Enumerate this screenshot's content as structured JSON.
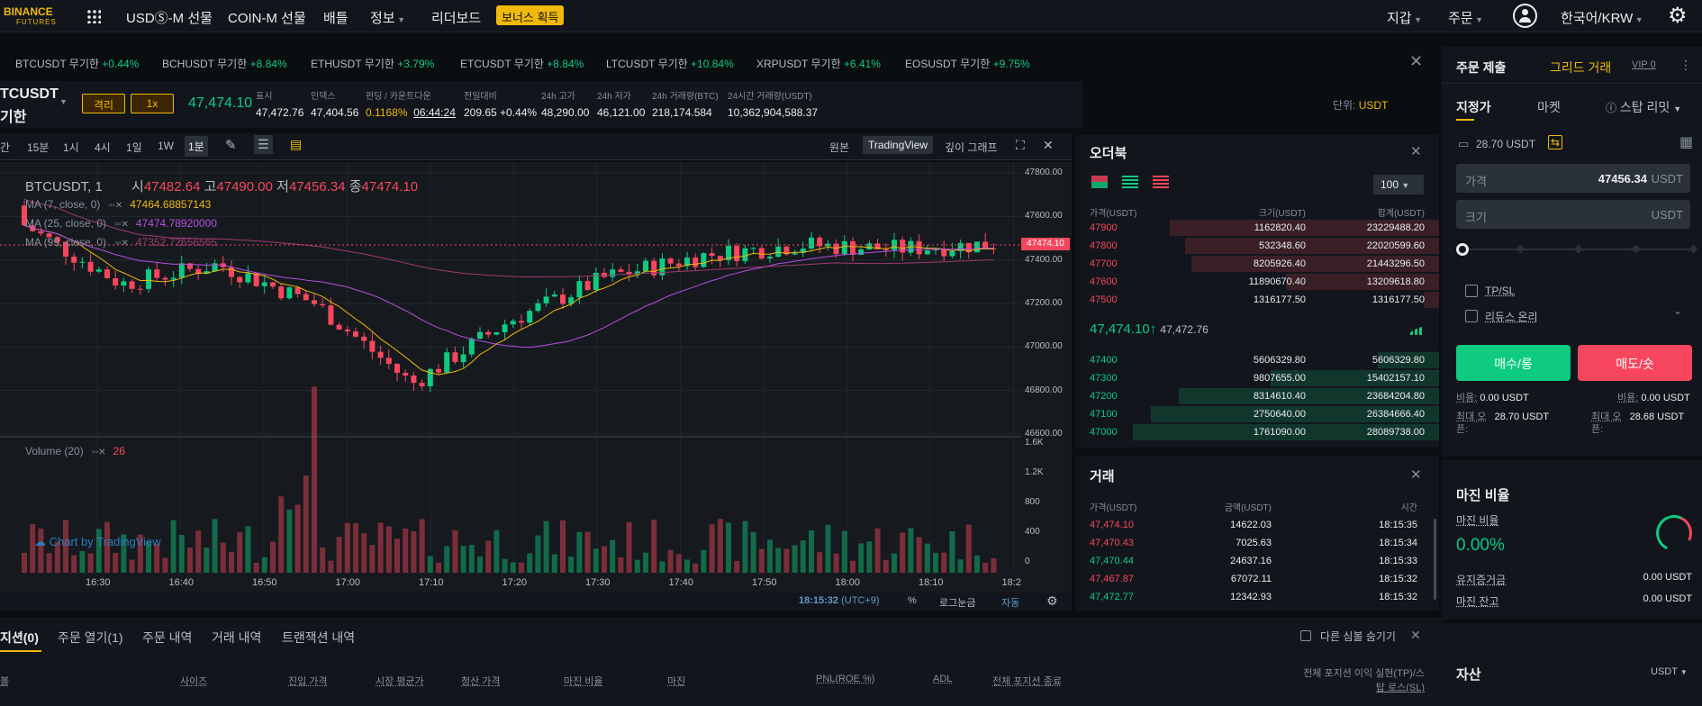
{
  "topbar": {
    "logo_line1": "BINANCE",
    "logo_line2": "FUTURES",
    "nav": [
      "USDⓈ-M 선물",
      "COIN-M 선물",
      "배틀",
      "정보",
      "리더보드"
    ],
    "bonus": "보너스 획득",
    "wallet": "지갑",
    "orders": "주문",
    "language": "한국어/KRW"
  },
  "ticker": [
    {
      "name": "BTCUSDT 무기한",
      "chg": "+0.44%"
    },
    {
      "name": "BCHUSDT 무기한",
      "chg": "+8.84%"
    },
    {
      "name": "ETHUSDT 무기한",
      "chg": "+3.79%"
    },
    {
      "name": "ETCUSDT 무기한",
      "chg": "+8.84%"
    },
    {
      "name": "LTCUSDT 무기한",
      "chg": "+10.84%"
    },
    {
      "name": "XRPUSDT 무기한",
      "chg": "+6.41%"
    },
    {
      "name": "EOSUSDT 무기한",
      "chg": "+9.75%"
    }
  ],
  "header": {
    "symbol": "TCUSDT",
    "sub": "기한",
    "margin_mode": "격리",
    "leverage": "1x",
    "price": "47,474.10",
    "stats": [
      {
        "l": "표시",
        "v": "47,472.76"
      },
      {
        "l": "인덱스",
        "v": "47,404.56"
      },
      {
        "l": "펀딩 / 카운트다운",
        "v": "0.1168%",
        "v2": "06:44:24"
      },
      {
        "l": "전일대비",
        "v": "209.65 +0.44%"
      },
      {
        "l": "24h 고가",
        "v": "48,290.00"
      },
      {
        "l": "24h 저가",
        "v": "46,121.00"
      },
      {
        "l": "24h 거래량(BTC)",
        "v": "218,174.584"
      },
      {
        "l": "24시간 거래량(USDT)",
        "v": "10,362,904,588.37"
      }
    ],
    "unit_label": "단위:",
    "unit": "USDT"
  },
  "toolbar": {
    "intervals": [
      "간",
      "15분",
      "1시",
      "4시",
      "1일",
      "1W",
      "1분"
    ],
    "views": [
      "원본",
      "TradingView",
      "깊이 그래프"
    ]
  },
  "chart": {
    "legend_title": "BTCUSDT, 1",
    "o_l": "시",
    "o": "47482.64",
    "h_l": "고",
    "h": "47490.00",
    "l_l": "저",
    "l": "47456.34",
    "c_l": "종",
    "c": "47474.10",
    "ma7": "MA (7, close, 0)",
    "ma7v": "47464.68857143",
    "ma25": "MA (25, close, 0)",
    "ma25v": "47474.78920000",
    "ma99": "MA (99, close, 0)",
    "ma99v": "47352.72656565",
    "vol_label": "Volume (20)",
    "vol_val": "26",
    "watermark": "Chart by TradingView",
    "last_price": "47474.10",
    "price_ticks": [
      "47800.00",
      "47600.00",
      "47400.00",
      "47200.00",
      "47000.00",
      "46800.00",
      "46600.00"
    ],
    "vol_ticks": [
      "1.6K",
      "1.2K",
      "800",
      "400",
      "0"
    ],
    "time_ticks": [
      "16:30",
      "16:40",
      "16:50",
      "17:00",
      "17:10",
      "17:20",
      "17:30",
      "17:40",
      "17:50",
      "18:00",
      "18:10",
      "18:2"
    ],
    "clock": "18:15:32",
    "tz": "(UTC+9)",
    "pct": "%",
    "log": "로그눈금",
    "auto": "자동",
    "colors": {
      "up": "#0ecb81",
      "down": "#f6465d",
      "ma7": "#f0b90b",
      "ma25": "#b54fe0",
      "ma99": "#a03a70"
    }
  },
  "chart_data": {
    "type": "candlestick",
    "x": [
      "16:30",
      "16:40",
      "16:50",
      "17:00",
      "17:10",
      "17:20",
      "17:30",
      "17:40",
      "17:50",
      "18:00",
      "18:10"
    ],
    "ylim": [
      46600,
      47800
    ],
    "close": [
      47560,
      47290,
      47380,
      47200,
      46830,
      47120,
      47320,
      47420,
      47470,
      47450,
      47474.1
    ]
  },
  "orderbook": {
    "title": "오더북",
    "depth": "100",
    "cols": [
      "가격(USDT)",
      "크기(USDT)",
      "합계(USDT)"
    ],
    "asks": [
      {
        "p": "47900",
        "s": "1162820.40",
        "t": "23229488.20",
        "d": 0.88
      },
      {
        "p": "47800",
        "s": "532348.60",
        "t": "22020599.60",
        "d": 0.83
      },
      {
        "p": "47700",
        "s": "8205926.40",
        "t": "21443296.50",
        "d": 0.81
      },
      {
        "p": "47600",
        "s": "11890670.40",
        "t": "13209618.80",
        "d": 0.5
      },
      {
        "p": "47500",
        "s": "1316177.50",
        "t": "1316177.50",
        "d": 0.05
      }
    ],
    "mid_price": "47,474.10",
    "mid_arrow": "↑",
    "mark": "47,472.76",
    "bids": [
      {
        "p": "47400",
        "s": "5606329.80",
        "t": "5606329.80",
        "d": 0.2
      },
      {
        "p": "47300",
        "s": "9807655.00",
        "t": "15402157.10",
        "d": 0.55
      },
      {
        "p": "47200",
        "s": "8314610.40",
        "t": "23684204.80",
        "d": 0.85
      },
      {
        "p": "47100",
        "s": "2750640.00",
        "t": "26384666.40",
        "d": 0.94
      },
      {
        "p": "47000",
        "s": "1761090.00",
        "t": "28089738.00",
        "d": 1.0
      }
    ]
  },
  "trades": {
    "title": "거래",
    "cols": [
      "가격(USDT)",
      "금액(USDT)",
      "시간"
    ],
    "rows": [
      {
        "p": "47,474.10",
        "a": "14622.03",
        "t": "18:15:35",
        "c": "red"
      },
      {
        "p": "47,470.43",
        "a": "7025.63",
        "t": "18:15:34",
        "c": "red"
      },
      {
        "p": "47,470.44",
        "a": "24637.16",
        "t": "18:15:33",
        "c": "green"
      },
      {
        "p": "47,467.87",
        "a": "67072.11",
        "t": "18:15:32",
        "c": "red"
      },
      {
        "p": "47,472.77",
        "a": "12342.93",
        "t": "18:15:32",
        "c": "green"
      }
    ]
  },
  "order": {
    "title": "주문 제출",
    "grid": "그리드 거래",
    "vip": "VIP 0",
    "tabs": [
      "지정가",
      "마켓",
      "스탑 리밋"
    ],
    "balance": "28.70 USDT",
    "price_label": "가격",
    "price_val": "47456.34",
    "unit": "USDT",
    "size_label": "크기",
    "tpsl": "TP/SL",
    "reduce": "리듀스 온리",
    "buy": "매수/롱",
    "sell": "매도/숏",
    "cost_l": "비용:",
    "cost_buy": "0.00 USDT",
    "cost_sell": "0.00 USDT",
    "max_l": "최대 오",
    "max_l2": "픈:",
    "max_buy": "28.70 USDT",
    "max_sell": "28.68 USDT"
  },
  "margin": {
    "title": "마진 비율",
    "ratio_label": "마진 비율",
    "ratio": "0.00%",
    "maint_label": "유지증거금",
    "maint": "0.00 USDT",
    "bal_label": "마진 잔고",
    "bal": "0.00 USDT"
  },
  "asset": {
    "title": "자산",
    "unit": "USDT"
  },
  "bottom": {
    "tabs": [
      "지션(0)",
      "주문 열기(1)",
      "주문 내역",
      "거래 내역",
      "트랜잭션 내역"
    ],
    "hide": "다른 심볼 숨기기",
    "cols": [
      "볼",
      "사이즈",
      "진입 가격",
      "시장 평균가",
      "청산 가격",
      "마진 비율",
      "마진",
      "PNL(ROE %)",
      "ADL",
      "전체 포지션 종료"
    ],
    "tp1": "전체 포지션 이익 실현(TP)/스",
    "tp2": "탑 로스(SL)"
  }
}
